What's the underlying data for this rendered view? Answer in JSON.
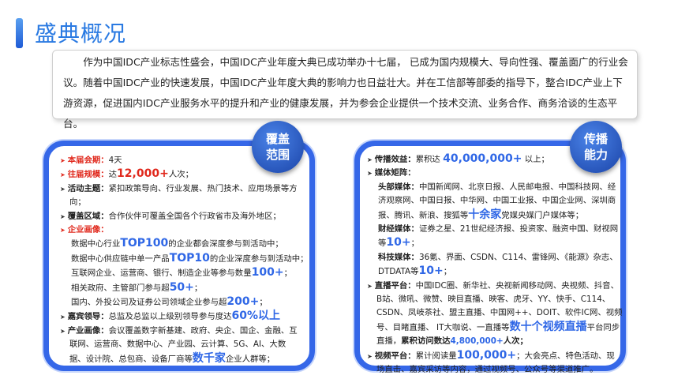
{
  "title": "盛典概况",
  "intro": "作为中国IDC产业标志性盛会，中国IDC产业年度大典已成功举办十七届， 已成为国内规模大、导向性强、覆盖面广的行业会议。随着中国IDC产业的快速发展，中国IDC产业年度大典的影响力也日益壮大。并在工信部等部委的指导下，整合IDC产业上下游资源，促进国内IDC产业服务水平的提升和产业的健康发展，并为参会企业提供一个技术交流、业务合作、商务洽谈的生态平台。",
  "left_badge": "覆盖范围",
  "right_badge": "传播能力",
  "left": {
    "l1_label": "本届会期：",
    "l1_value": "4天",
    "l2_label": "往届规模：",
    "l2_pre": "达",
    "l2_big": "12,000+",
    "l2_post": "人次；",
    "l3_label": "活动主题：",
    "l3_value": "紧扣政策导向、行业发展、热门技术、应用场景等方向；",
    "l4_label": "覆盖区域：",
    "l4_value": "合作伙伴可覆盖全国各个行政省市及海外地区；",
    "l5_label": "企业画像：",
    "l5_a_pre": "数据中心行业",
    "l5_a_big": "TOP100",
    "l5_a_post": "的企业都会深度参与到活动中；",
    "l5_b_pre": "数据中心供应链中单一产品",
    "l5_b_big": "TOP10",
    "l5_b_post": "的企业深度参与到活动中；",
    "l5_c_pre": "互联网企业、运营商、银行、制造企业等参与数量",
    "l5_c_big": "100+",
    "l5_c_post": "；",
    "l5_d_pre": "相关政府、主管部门参与超",
    "l5_d_big": "50+",
    "l5_d_post": "；",
    "l5_e_pre": "国内、外投公司及证券公司领域企业参与超",
    "l5_e_big": "200+",
    "l5_e_post": "；",
    "l6_label": "嘉宾领导：",
    "l6_pre": "总监及总监以上级别领导参与度达",
    "l6_big": "60%以上",
    "l7_label": "产业画像：",
    "l7_pre": "会议覆盖数字新基建、政府、央企、国企、金融、互联网、运营商、数据中心、产业园、云计算、5G、AI、大数据、设计院、总包商、设备厂商等",
    "l7_big": "数千家",
    "l7_post": "企业人群等；"
  },
  "right": {
    "r1_label": "传播效益：",
    "r1_pre": "累积达",
    "r1_big": "40,000,000+",
    "r1_post": "以上；",
    "r2_label": "媒体矩阵：",
    "r2a_label": "头部媒体：",
    "r2a_pre": "中国新闻网、北京日报、人民邮电报、中国科技网、经济观察网、中国日报、中华网、中国工业报、中国企业网、深圳商报、腾讯、新浪、搜狐等",
    "r2a_big": "十余家",
    "r2a_post": "党媒央媒门户媒体等；",
    "r2b_label": "财经媒体：",
    "r2b_pre": "证券之星、21世纪经济报、投资家、融资中国、财视网等",
    "r2b_big": "10+",
    "r2b_post": "；",
    "r2c_label": "科技媒体：",
    "r2c_pre": "36氪、界面、CSDN、C114、雷锋网、《能源》杂志、DTDATA等",
    "r2c_big": "10+",
    "r2c_post": "；",
    "r3_label": "直播平台：",
    "r3_pre": "中国IDC圈、新华社、央视新闻移动网、央视频、抖音、 B站、微吼、微赞、映目直播、映客、虎牙、YY、快手、C114、CSDN、凤岐茶社、盟主直播、中国网++、DOIT、软件IC网、视频号、目睹直播、 IT大咖说、一直播等",
    "r3_big": "数十个视频直播",
    "r3_mid": "平台同步直播，",
    "r3_bold": "累积访问数达",
    "r3_num": "4,800,000+",
    "r3_end": "人次；",
    "r4_label": "视频平台：",
    "r4_pre": "累计阅读量",
    "r4_big": "100,000+",
    "r4_post": "；大会亮点、特色活动、现场直击、嘉宾采访等内容，通过视频号、公众号等渠道推广。"
  }
}
